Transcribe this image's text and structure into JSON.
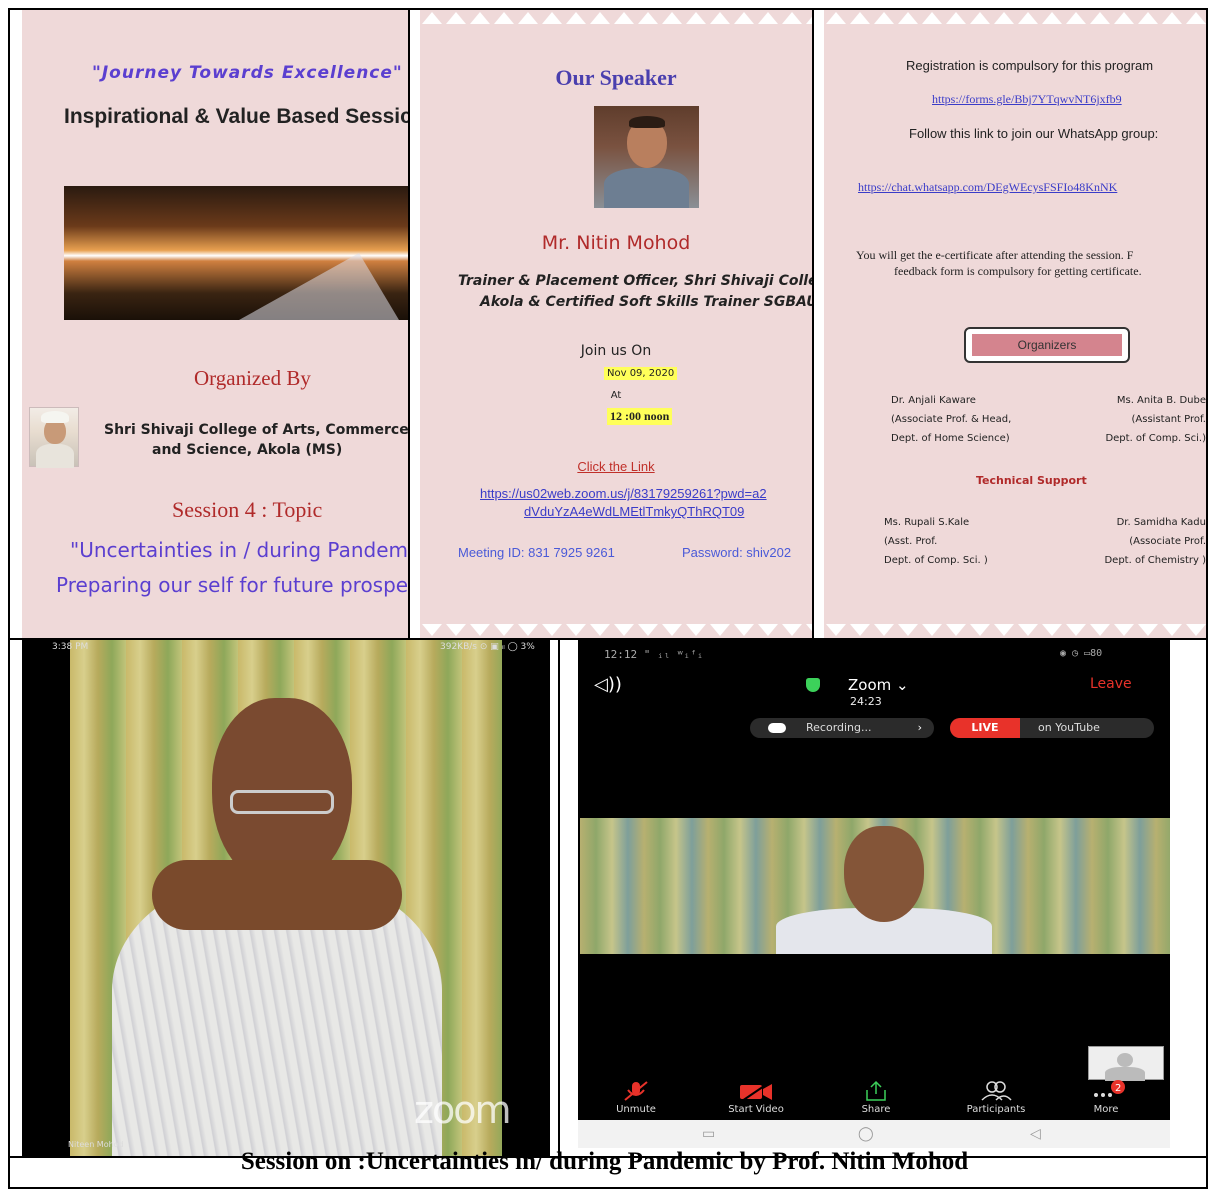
{
  "panel1": {
    "quote": "\"Journey Towards Excellence\"",
    "title": "Inspirational & Value Based Sessic",
    "organized_by": "Organized By",
    "college_line1": "Shri Shivaji College of Arts, Commerce",
    "college_line2": "and Science, Akola (MS)",
    "session": "Session 4 : Topic",
    "topic_line1": "\"Uncertainties in / during Pandemic",
    "topic_line2": "Preparing our self for future prospec"
  },
  "panel2": {
    "heading": "Our Speaker",
    "name": "Mr. Nitin Mohod",
    "role_line1": "Trainer & Placement Officer, Shri Shivaji Colle",
    "role_line2": "Akola & Certified Soft Skills Trainer SGBAU",
    "join": "Join us On",
    "date": "Nov 09, 2020",
    "at": "At",
    "time": "12 :00 noon",
    "click": "Click the Link",
    "link_line1": "https://us02web.zoom.us/j/83179259261?pwd=a2",
    "link_line2": "dVduYzA4eWdLMEtlTmkyQThRQT09",
    "meeting_id": "Meeting ID: 831 7925 9261",
    "password": "Password: shiv202"
  },
  "panel3": {
    "registration": "Registration is compulsory for this program",
    "form_link": "https://forms.gle/Bbj7YTqwvNT6jxfb9",
    "follow": "Follow this link to join our WhatsApp group:",
    "whatsapp_link": "https://chat.whatsapp.com/DEgWEcysFSFIo48KnNK",
    "cert_line1": "You will get the e-certificate after attending the session. F",
    "cert_line2": "feedback form is compulsory for getting certificate.",
    "organizers_label": "Organizers",
    "organizers": [
      {
        "name": "Dr. Anjali Kaware",
        "post": "(Associate  Prof. & Head,",
        "dept": "Dept. of Home Science)"
      },
      {
        "name": "Ms. Anita B. Dube",
        "post": "(Assistant Prof.",
        "dept": "Dept. of Comp. Sci.)"
      }
    ],
    "tech_label": "Technical Support",
    "tech": [
      {
        "name": "Ms. Rupali S.Kale",
        "post": "(Asst. Prof.",
        "dept": "Dept. of Comp. Sci. )"
      },
      {
        "name": "Dr. Samidha Kadu",
        "post": "(Associate Prof.",
        "dept": "Dept. of Chemistry )"
      }
    ]
  },
  "video1": {
    "time": "3:38 PM",
    "status": "392KB/s ⊙ ▣ ᵢₗ ◯ 3%",
    "watermark": "zoom",
    "participant": "Niteen Mohod"
  },
  "video2": {
    "status_left": "12:12 \" ᵢₗ ʷᵢᶠᵢ",
    "status_right": "◉ ◷ ▭80",
    "app": "Zoom",
    "timer": "24:23",
    "leave": "Leave",
    "recording": "Recording...",
    "live": "LIVE",
    "youtube": "on YouTube",
    "more_badge": "2",
    "toolbar": [
      {
        "label": "Unmute",
        "icon": "mic-muted-icon"
      },
      {
        "label": "Start Video",
        "icon": "video-off-icon"
      },
      {
        "label": "Share",
        "icon": "share-icon"
      },
      {
        "label": "Participants",
        "icon": "participants-icon"
      },
      {
        "label": "More",
        "icon": "more-icon"
      }
    ]
  },
  "caption": "Session on :Uncertainties in/ during Pandemic by Prof. Nitin Mohod",
  "colors": {
    "flyer_bg": "#efd9d9",
    "accent_red": "#b02a2a",
    "accent_purple": "#5b3fd0",
    "link_blue": "#3a3cc8",
    "zoom_leave": "#e8322a"
  }
}
